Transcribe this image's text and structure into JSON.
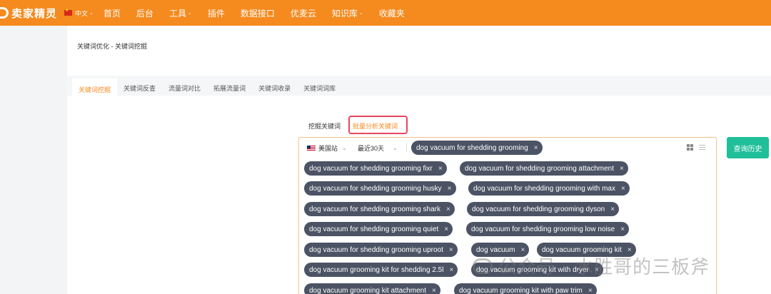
{
  "header": {
    "logo_text": "卖家精灵",
    "lang_label": "中文",
    "nav": [
      {
        "label": "首页",
        "dropdown": false
      },
      {
        "label": "后台",
        "dropdown": false
      },
      {
        "label": "工具",
        "dropdown": true
      },
      {
        "label": "插件",
        "dropdown": false
      },
      {
        "label": "数据接口",
        "dropdown": false
      },
      {
        "label": "优麦云",
        "dropdown": false
      },
      {
        "label": "知识库",
        "dropdown": true
      },
      {
        "label": "收藏夹",
        "dropdown": false
      }
    ],
    "brand_color": "#f58a1e"
  },
  "breadcrumb": "关键词优化 - 关键词挖掘",
  "tabs": [
    "关键词挖掘",
    "关键词反查",
    "流量词对比",
    "拓展流量词",
    "关键词收录",
    "关键词词库"
  ],
  "active_tab": "关键词挖掘",
  "subtabs": [
    "挖掘关键词",
    "批量分析关键词"
  ],
  "active_subtab": "批量分析关键词",
  "filters": {
    "site": "美国站",
    "range": "最近30天"
  },
  "keywords": [
    "dog vacuum for shedding grooming",
    "dog vacuum for shedding grooming fixr",
    "dog vacuum for shedding grooming attachment",
    "dog vacuum for shedding grooming husky",
    "dog vacuum for shedding grooming with max",
    "dog vacuum for shedding grooming shark",
    "dog vacuum for shedding grooming dyson",
    "dog vacuum for shedding grooming quiet",
    "dog vacuum for shedding grooming low noise",
    "dog vacuum for shedding grooming uproot",
    "dog vacuum",
    "dog vacuum grooming kit",
    "dog vacuum grooming kit for shedding 2.5l",
    "dog vacuum grooming kit with dryer",
    "dog vacuum grooming kit attachment",
    "dog vacuum grooming kit with paw trim"
  ],
  "chip_remove_glyph": "×",
  "history_button": "查询历史",
  "watermark": "公众号 · 水胜哥的三板斧",
  "colors": {
    "chip_bg": "#4b5364",
    "history_btn": "#1fbf9a",
    "highlight_border": "#e8475f"
  }
}
